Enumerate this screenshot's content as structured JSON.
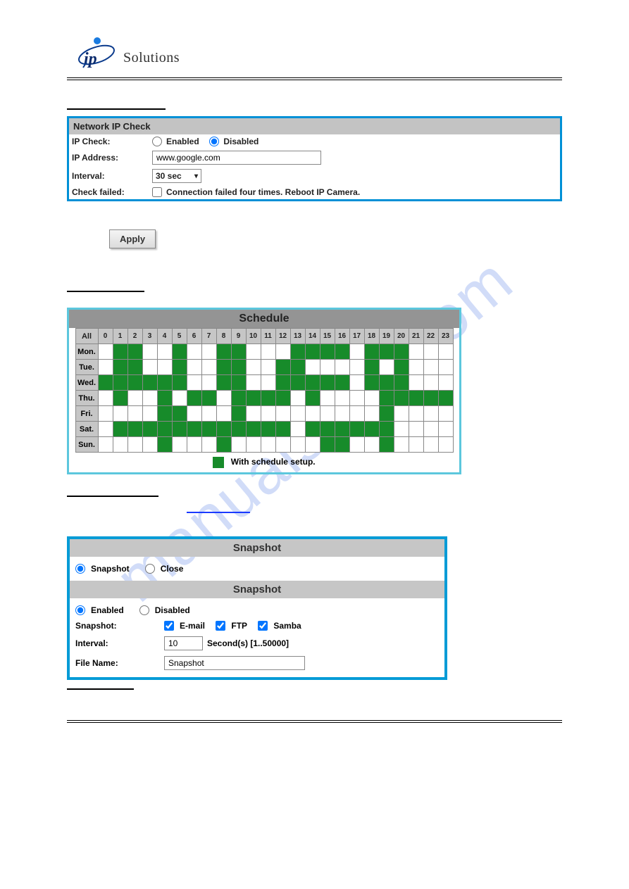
{
  "brand": {
    "name": "Solutions"
  },
  "watermark": "manualslive.com",
  "ipcheck": {
    "title": "Network IP Check",
    "label": "IP Check:",
    "enabled": "Enabled",
    "disabled": "Disabled",
    "selected": "disabled",
    "addr_label": "IP Address:",
    "addr_value": "www.google.com",
    "interval_label": "Interval:",
    "interval_value": "30 sec",
    "fail_label": "Check failed:",
    "fail_text": "Connection failed four times. Reboot IP Camera."
  },
  "apply": "Apply",
  "schedule": {
    "title": "Schedule",
    "all": "All",
    "hours": [
      "0",
      "1",
      "2",
      "3",
      "4",
      "5",
      "6",
      "7",
      "8",
      "9",
      "10",
      "11",
      "12",
      "13",
      "14",
      "15",
      "16",
      "17",
      "18",
      "19",
      "20",
      "21",
      "22",
      "23"
    ],
    "days": [
      "Mon.",
      "Tue.",
      "Wed.",
      "Thu.",
      "Fri.",
      "Sat.",
      "Sun."
    ],
    "legend": "With schedule setup.",
    "grid": [
      [
        0,
        1,
        1,
        0,
        0,
        1,
        0,
        0,
        1,
        1,
        0,
        0,
        0,
        1,
        1,
        1,
        1,
        0,
        1,
        1,
        1,
        0,
        0,
        0
      ],
      [
        0,
        1,
        1,
        0,
        0,
        1,
        0,
        0,
        1,
        1,
        0,
        0,
        1,
        1,
        0,
        0,
        0,
        0,
        1,
        0,
        1,
        0,
        0,
        0
      ],
      [
        1,
        1,
        1,
        1,
        1,
        1,
        0,
        0,
        1,
        1,
        0,
        0,
        1,
        1,
        1,
        1,
        1,
        0,
        1,
        1,
        1,
        0,
        0,
        0
      ],
      [
        0,
        1,
        0,
        0,
        1,
        0,
        1,
        1,
        0,
        1,
        1,
        1,
        1,
        0,
        1,
        0,
        0,
        0,
        0,
        1,
        1,
        1,
        1,
        1
      ],
      [
        0,
        0,
        0,
        0,
        1,
        1,
        0,
        0,
        0,
        1,
        0,
        0,
        0,
        0,
        0,
        0,
        0,
        0,
        0,
        1,
        0,
        0,
        0,
        0
      ],
      [
        0,
        1,
        1,
        1,
        1,
        1,
        1,
        1,
        1,
        1,
        1,
        1,
        1,
        0,
        1,
        1,
        1,
        1,
        1,
        1,
        0,
        0,
        0,
        0
      ],
      [
        0,
        0,
        0,
        0,
        1,
        0,
        0,
        0,
        1,
        0,
        0,
        0,
        0,
        0,
        0,
        1,
        1,
        0,
        0,
        1,
        0,
        0,
        0,
        0
      ]
    ]
  },
  "snapshot": {
    "bar1": "Snapshot",
    "opt_snapshot": "Snapshot",
    "opt_close": "Close",
    "sel_top": "snapshot",
    "bar2": "Snapshot",
    "enabled": "Enabled",
    "disabled": "Disabled",
    "sel_state": "enabled",
    "label": "Snapshot:",
    "email": "E-mail",
    "ftp": "FTP",
    "samba": "Samba",
    "chk": {
      "email": true,
      "ftp": true,
      "samba": true
    },
    "interval_label": "Interval:",
    "interval_value": "10",
    "interval_suffix": "Second(s) [1..50000]",
    "fname_label": "File Name:",
    "fname_value": "Snapshot"
  }
}
